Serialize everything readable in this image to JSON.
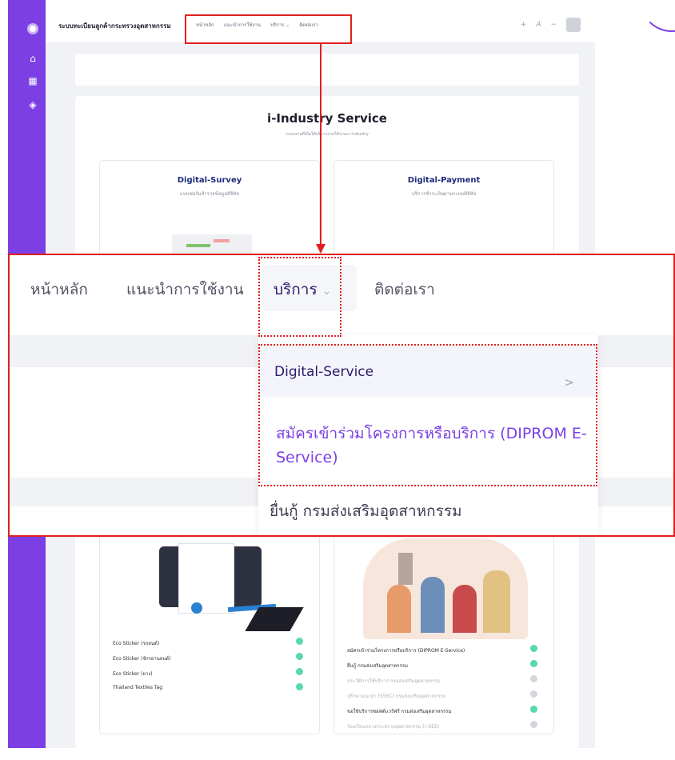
{
  "app": {
    "title": "ระบบทะเบียนลูกค้ากระทรวงอุตสาหกรรม"
  },
  "nav_small": [
    "หน้าหลัก",
    "แนะนำการใช้งาน",
    "บริการ ⌄",
    "ติดต่อเรา"
  ],
  "top_right": {
    "plus": "+",
    "font": "A",
    "minus": "−"
  },
  "sidebar_icons": [
    "home-icon",
    "grid-icon",
    "layers-icon"
  ],
  "service": {
    "title": "i-Industry Service",
    "subtitle": "ระบบงานที่เปิดให้บริการภายใต้ระบบ i-Industry"
  },
  "cards": {
    "survey": {
      "title": "Digital-Survey",
      "desc": "แบบฟอร์มสำรวจข้อมูลดิจิทัล"
    },
    "payment": {
      "title": "Digital-Payment",
      "desc": "บริการชำระเงินผ่านระบบดิจิทัล"
    }
  },
  "zoom_nav": [
    "หน้าหลัก",
    "แนะนำการใช้งาน",
    "บริการ",
    "ติดต่อเรา"
  ],
  "zoom_nav_chevron": "⌄",
  "menu": {
    "item1": "Digital-Service",
    "item1_chevron": ">",
    "item2": "สมัครเข้าร่วมโครงการหรือบริการ (DIPROM E-Service)",
    "item3": "ยื่นกู้ กรมส่งเสริมอุตสาหกรรม"
  },
  "left_features": [
    "Eco Sticker (รถยนต์)",
    "Eco Sticker (จักรยานยนต์)",
    "Eco Sticker (ยาง)",
    "Thailand Textiles Tag"
  ],
  "right_features": [
    {
      "label": "สมัครเข้าร่วมโครงการหรือบริการ (DIPROM E-Service)",
      "enabled": true
    },
    {
      "label": "ยื่นกู้ กรมส่งเสริมอุตสาหกรรม",
      "enabled": true
    },
    {
      "label": "ประวัติการใช้บริการ กรมส่งเสริมอุตสาหกรรม",
      "enabled": false
    },
    {
      "label": "ปรึกษาแนะนำ (SSRC) กรมส่งเสริมอุตสาหกรรม",
      "enabled": false
    },
    {
      "label": "ขอใช้บริการซอฟต์แวร์ฟรี กรมส่งเสริมอุตสาหกรรม",
      "enabled": true
    },
    {
      "label": "ร้องเรียนกลางกระทรวงอุตสาหกรรม (i-OEE)",
      "enabled": false
    }
  ],
  "colors": {
    "sidebar": "#7b3fe4",
    "annotation": "#e02020",
    "check_on": "#58d9a8",
    "check_off": "#d5d6dd",
    "link_purple": "#7b3fe4"
  }
}
